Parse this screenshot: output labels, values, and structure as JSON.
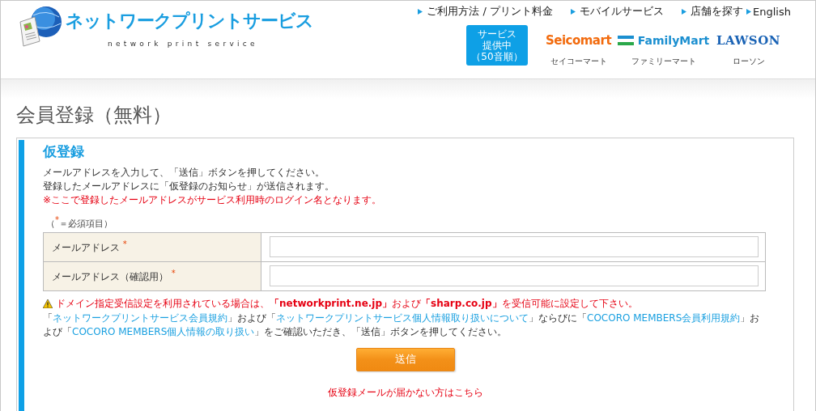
{
  "header": {
    "logo_title": "ネットワークプリントサービス",
    "logo_subtitle": "network print service",
    "nav": [
      {
        "label": "ご利用方法 / プリント料金"
      },
      {
        "label": "モバイルサービス"
      },
      {
        "label": "店舗を探す"
      },
      {
        "label": "English"
      }
    ],
    "stores_badge": [
      "サービス",
      "提供中",
      "（50音順）"
    ],
    "stores": [
      {
        "kind": "seicomart",
        "logo": "Seicomart",
        "label": "セイコーマート"
      },
      {
        "kind": "familymart",
        "logo": "FamilyMart",
        "label": "ファミリーマート"
      },
      {
        "kind": "lawson",
        "logo": "LAWSON",
        "label": "ローソン"
      }
    ]
  },
  "page_title": "会員登録（無料）",
  "section": {
    "heading": "仮登録",
    "intro": [
      "メールアドレスを入力して、「送信」ボタンを押してください。",
      "登録したメールアドレスに「仮登録のお知らせ」が送信されます。"
    ],
    "notice": "※ここで登録したメールアドレスがサービス利用時のログイン名となります。",
    "required_note": "（$^{*}$＝必須項目）",
    "fields": [
      {
        "label": "メールアドレス $^{*}$"
      },
      {
        "label": "メールアドレス（確認用） $^{*}$"
      }
    ],
    "warning": "ドメイン指定受信設定を利用されている場合は、**「networkprint.ne.jp」**および**「sharp.co.jp」**を受信可能に設定して下さい。",
    "consent": [
      {
        "kind": "text",
        "text": "「"
      },
      {
        "kind": "link",
        "text": "ネットワークプリントサービス会員規約"
      },
      {
        "kind": "text",
        "text": "」および「"
      },
      {
        "kind": "link",
        "text": "ネットワークプリントサービス個人情報取り扱いについて"
      },
      {
        "kind": "text",
        "text": "」ならびに「"
      },
      {
        "kind": "link",
        "text": "COCORO MEMBERS会員利用規約"
      },
      {
        "kind": "text",
        "text": "」および「"
      },
      {
        "kind": "link",
        "text": "COCORO MEMBERS個人情報の取り扱い"
      },
      {
        "kind": "text",
        "text": "」をご確認いただき、「送信」ボタンを押してください。"
      }
    ],
    "submit": "送信",
    "help_link": "仮登録メールが届かない方はこちら"
  }
}
